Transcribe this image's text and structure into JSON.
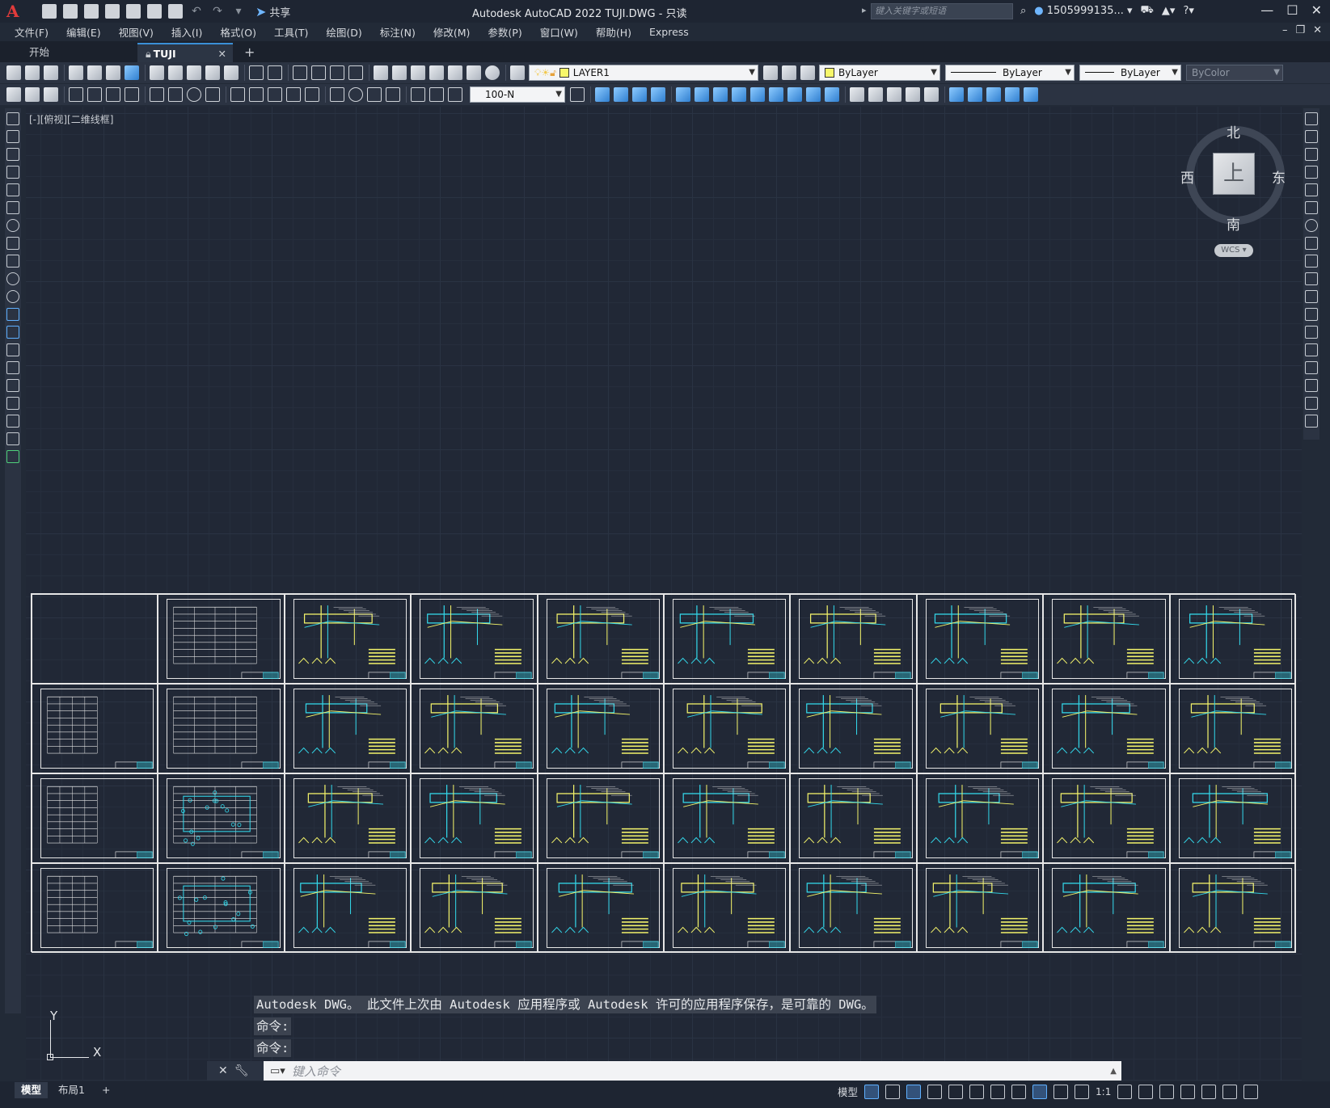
{
  "titlebar": {
    "logo": "A",
    "share_label": "共享",
    "title": "Autodesk AutoCAD 2022    TUJI.DWG - 只读",
    "search_placeholder": "键入关键字或短语",
    "user": "1505999135...",
    "win_min": "—",
    "win_max": "☐",
    "win_close": "✕"
  },
  "menubar": {
    "items": [
      "文件(F)",
      "编辑(E)",
      "视图(V)",
      "插入(I)",
      "格式(O)",
      "工具(T)",
      "绘图(D)",
      "标注(N)",
      "修改(M)",
      "参数(P)",
      "窗口(W)",
      "帮助(H)",
      "Express"
    ]
  },
  "filetabs": {
    "start": "开始",
    "active": "TUJI",
    "add": "+"
  },
  "toolbar": {
    "layer": "LAYER1",
    "color": "ByLayer",
    "linetype": "ByLayer",
    "lineweight": "ByLayer",
    "plotstyle": "ByColor",
    "dimstyle": "100-N"
  },
  "viewport": {
    "label": "[-][俯视][二维线框]"
  },
  "viewcube": {
    "north": "北",
    "south": "南",
    "east": "东",
    "west": "西",
    "top": "上",
    "wcs": "WCS"
  },
  "ucs": {
    "x": "X",
    "y": "Y"
  },
  "command": {
    "history": [
      "Autodesk DWG。  此文件上次由 Autodesk 应用程序或 Autodesk 许可的应用程序保存，是可靠的 DWG。",
      "命令:",
      "命令:"
    ],
    "placeholder": "键入命令"
  },
  "layout_tabs": [
    "模型",
    "布局1",
    "+"
  ],
  "status": {
    "model": "模型",
    "scale": "1:1"
  },
  "sheet_grid": {
    "rows": 4,
    "cols": 10
  },
  "colors": {
    "background": "#212836",
    "yellow_linework": "#f2f26a",
    "cyan_linework": "#33d6e8",
    "white_linework": "#e6e6e6"
  }
}
